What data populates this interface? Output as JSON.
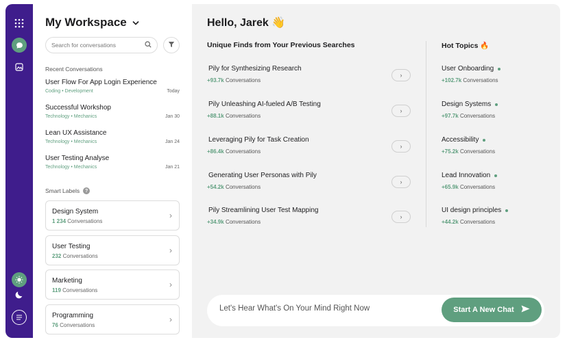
{
  "workspace": {
    "title": "My Workspace"
  },
  "search": {
    "placeholder": "Search for conversations"
  },
  "recent": {
    "label": "Recent Conversations",
    "items": [
      {
        "title": "User Flow For App Login Experience",
        "tag1": "Coding",
        "tag2": "Development",
        "date": "Today"
      },
      {
        "title": "Successful Workshop",
        "tag1": "Technology",
        "tag2": "Mechanics",
        "date": "Jan 30"
      },
      {
        "title": "Lean UX Assistance",
        "tag1": "Technology",
        "tag2": "Mechanics",
        "date": "Jan 24"
      },
      {
        "title": "User Testing Analyse",
        "tag1": "Technology",
        "tag2": "Mechanics",
        "date": "Jan 21"
      }
    ]
  },
  "smart_labels": {
    "label": "Smart Labels",
    "items": [
      {
        "name": "Design System",
        "count": "1 234",
        "unit": "Conversations"
      },
      {
        "name": "User Testing",
        "count": "232",
        "unit": "Conversations"
      },
      {
        "name": "Marketing",
        "count": "119",
        "unit": "Conversations"
      },
      {
        "name": "Programming",
        "count": "76",
        "unit": "Conversations"
      }
    ]
  },
  "greeting": "Hello, Jarek 👋",
  "finds": {
    "title": "Unique Finds from Your Previous Searches",
    "items": [
      {
        "title": "Pily for Synthesizing Research",
        "count": "+93.7k",
        "unit": "Conversations"
      },
      {
        "title": "Pily Unleashing AI-fueled A/B Testing",
        "count": "+88.1k",
        "unit": "Conversations"
      },
      {
        "title": "Leveraging Pily for Task Creation",
        "count": "+86.4k",
        "unit": "Conversations"
      },
      {
        "title": "Generating User Personas with Pily",
        "count": "+54.2k",
        "unit": "Conversations"
      },
      {
        "title": "Pily Streamlining User Test Mapping",
        "count": "+34.9k",
        "unit": "Conversations"
      }
    ]
  },
  "topics": {
    "title": "Hot Topics 🔥",
    "items": [
      {
        "title": "User Onboarding",
        "count": "+102.7k",
        "unit": "Conversations"
      },
      {
        "title": "Design Systems",
        "count": "+97.7k",
        "unit": "Conversations"
      },
      {
        "title": "Accessibility",
        "count": "+75.2k",
        "unit": "Conversations"
      },
      {
        "title": "Lead Innovation",
        "count": "+65.9k",
        "unit": "Conversations"
      },
      {
        "title": "UI design principles",
        "count": "+44.2k",
        "unit": "Conversations"
      }
    ]
  },
  "chat": {
    "placeholder": "Let's Hear What's On Your Mind Right Now",
    "button": "Start A New Chat"
  },
  "icons": {
    "rail": [
      "apps-grid-icon",
      "chat-icon",
      "image-icon",
      "sun-icon",
      "moon-icon",
      "menu-icon"
    ],
    "search": "search-icon",
    "filter": "filter-icon",
    "chevron": "chevron-right-icon",
    "send": "send-icon"
  },
  "colors": {
    "rail": "#3f1d8c",
    "accent": "#5f9f7f",
    "main_bg": "#f2f2f2"
  }
}
